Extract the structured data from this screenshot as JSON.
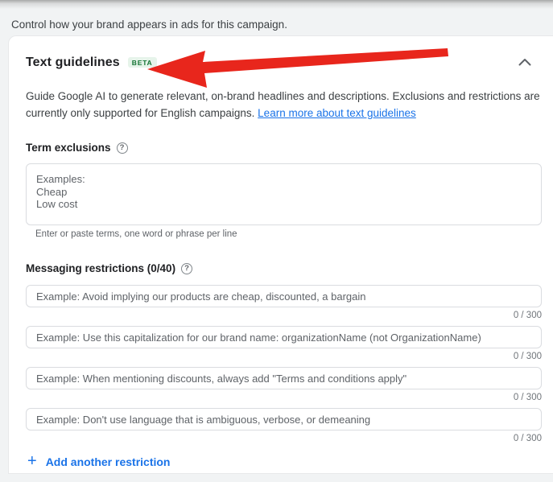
{
  "page": {
    "intro": "Control how your brand appears in ads for this campaign."
  },
  "card": {
    "title": "Text guidelines",
    "beta_label": "BETA",
    "description": "Guide Google AI to generate relevant, on-brand headlines and descriptions. Exclusions and restrictions are currently only supported for English campaigns.",
    "learn_more_link": "Learn more about text guidelines"
  },
  "term_exclusions": {
    "label": "Term exclusions",
    "placeholder": "Examples:\nCheap\nLow cost",
    "helper": "Enter or paste terms, one word or phrase per line"
  },
  "messaging_restrictions": {
    "label": "Messaging restrictions (0/40)",
    "fields": [
      {
        "placeholder": "Example: Avoid implying our products are cheap, discounted, a bargain",
        "counter": "0 / 300"
      },
      {
        "placeholder": "Example: Use this capitalization for our brand name: organizationName (not OrganizationName)",
        "counter": "0 / 300"
      },
      {
        "placeholder": "Example: When mentioning discounts, always add \"Terms and conditions apply\"",
        "counter": "0 / 300"
      },
      {
        "placeholder": "Example: Don't use language that is ambiguous, verbose, or demeaning",
        "counter": "0 / 300"
      }
    ],
    "add_button_label": "Add another restriction"
  },
  "icons": {
    "help_glyph": "?",
    "plus_glyph": "+"
  },
  "colors": {
    "accent_blue": "#1a73e8",
    "beta_green_bg": "#e6f4ea",
    "beta_green_text": "#137333",
    "arrow_red": "#e8261c"
  }
}
